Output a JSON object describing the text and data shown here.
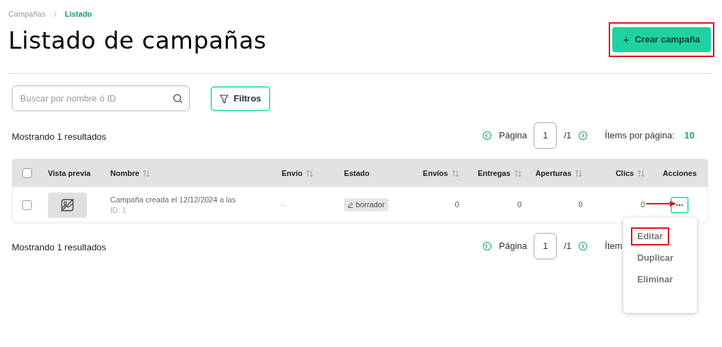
{
  "breadcrumb": [
    {
      "label": "Campañas",
      "selected": false
    },
    {
      "label": "Listado",
      "selected": true
    }
  ],
  "title": "Listado de campañas",
  "create_button": {
    "icon": "+",
    "label": "Crear campaña",
    "highlighted": true
  },
  "search": {
    "placeholder": "Buscar por nombre ó ID"
  },
  "filters_button": {
    "label": "Filtros"
  },
  "top_bar": {
    "results": "Mostrando 1 resultados",
    "page_label": "Página",
    "page": "1",
    "page_total": "/1",
    "items_label": "Ítems por página:",
    "items_value": "10"
  },
  "table": {
    "header_checked": false,
    "columns": [
      {
        "label": "Vista previa",
        "sortable": false
      },
      {
        "label": "Nombre",
        "sortable": true
      },
      {
        "label": "Envío",
        "sortable": true
      },
      {
        "label": "Estado",
        "sortable": false
      },
      {
        "label": "Envíos",
        "sortable": true
      },
      {
        "label": "Entregas",
        "sortable": true
      },
      {
        "label": "Aperturas",
        "sortable": true
      },
      {
        "label": "Clics",
        "sortable": true
      },
      {
        "label": "Acciones",
        "sortable": false
      }
    ],
    "rows": [
      {
        "checked": false,
        "name": "Campaña creada el 12/12/2024 a las",
        "id": "ID: 1",
        "envio": "-",
        "estado": "borrador",
        "envios": "0",
        "entregas": "0",
        "aperturas": "0",
        "clics": "0",
        "arrow_annotation": true
      }
    ]
  },
  "actions_menu": {
    "open": true,
    "items": [
      {
        "label": "Editar",
        "highlighted": true
      },
      {
        "label": "Duplicar",
        "highlighted": false
      },
      {
        "label": "Eliminar",
        "highlighted": false
      }
    ]
  },
  "bottom_bar": {
    "results": "Mostrando 1 resultados",
    "page_label": "Página",
    "page": "1",
    "page_total": "/1",
    "items_label": "Ítem"
  }
}
